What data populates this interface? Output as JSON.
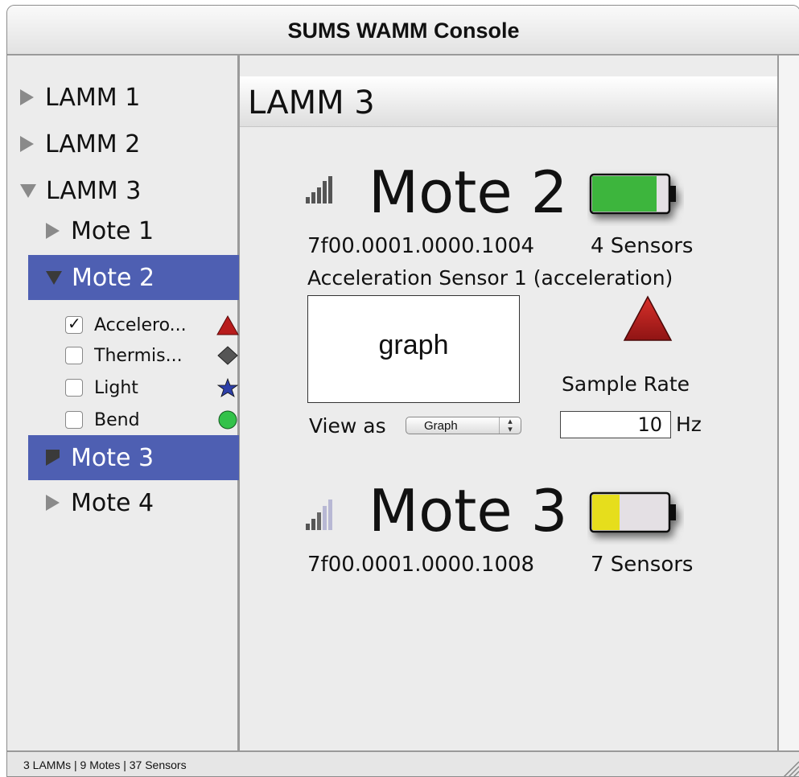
{
  "window": {
    "title": "SUMS WAMM Console"
  },
  "sidebar": {
    "lamms": [
      {
        "label": "LAMM 1",
        "expanded": false
      },
      {
        "label": "LAMM 2",
        "expanded": false
      },
      {
        "label": "LAMM 3",
        "expanded": true
      }
    ],
    "motes": [
      {
        "label": "Mote 1",
        "expanded": false,
        "selected": false
      },
      {
        "label": "Mote 2",
        "expanded": true,
        "selected": true
      },
      {
        "label": "Mote 3",
        "expanded": false,
        "selected": true
      },
      {
        "label": "Mote 4",
        "expanded": false,
        "selected": false
      }
    ],
    "sensors": [
      {
        "label": "Accelero...",
        "checked": true,
        "icon": "red-triangle-icon"
      },
      {
        "label": "Thermis...",
        "checked": false,
        "icon": "gray-diamond-icon"
      },
      {
        "label": "Light",
        "checked": false,
        "icon": "blue-star-icon"
      },
      {
        "label": "Bend",
        "checked": false,
        "icon": "green-circle-icon"
      }
    ]
  },
  "main": {
    "header": "LAMM 3",
    "motes": [
      {
        "title": "Mote 2",
        "id_text": "7f00.0001.0000.1004",
        "sensors_text": "4 Sensors",
        "battery_color": "#3db53d",
        "sensor_desc": "Acceleration Sensor 1 (acceleration)",
        "graph_label": "graph",
        "view_as_label": "View as",
        "view_as_value": "Graph",
        "sample_rate_label": "Sample Rate",
        "sample_rate_value": "10",
        "sample_rate_unit": "Hz"
      },
      {
        "title": "Mote 3",
        "id_text": "7f00.0001.0000.1008",
        "sensors_text": "7 Sensors",
        "battery_color": "#e6de1e"
      }
    ]
  },
  "status": {
    "text": "3 LAMMs | 9 Motes | 37 Sensors"
  },
  "colors": {
    "selection": "#4e5fb2",
    "triangle_red": "#b81c1c",
    "battery_green": "#3db53d",
    "battery_yellow": "#e6de1e"
  }
}
